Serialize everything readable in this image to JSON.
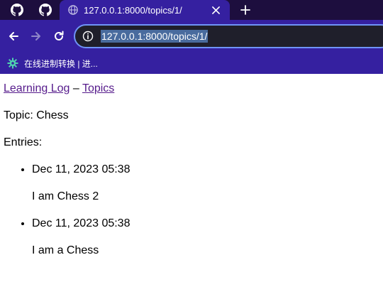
{
  "browser": {
    "pinned_tabs": [
      {
        "icon": "github-icon"
      },
      {
        "icon": "github-icon"
      }
    ],
    "active_tab": {
      "icon": "globe-icon",
      "title": "127.0.0.1:8000/topics/1/",
      "close_icon": "close-icon"
    },
    "new_tab_icon": "plus-icon",
    "toolbar": {
      "back_icon": "back-arrow-icon",
      "forward_icon": "forward-arrow-icon",
      "reload_icon": "reload-icon",
      "url": "127.0.0.1:8000/topics/1/",
      "site_info_icon": "info-icon"
    },
    "bookmarks": [
      {
        "icon": "gear-icon",
        "label": "在线进制转换 | 进..."
      }
    ],
    "colors": {
      "tabstrip": "#1d0e3e",
      "toolbar": "#3520a0",
      "omnibox_bg": "#1f1f2b",
      "omnibox_border": "#6f93f7",
      "url_highlight": "#496b9e"
    }
  },
  "page": {
    "nav": {
      "home_link": "Learning Log",
      "separator": "–",
      "topics_link": "Topics"
    },
    "topic_line": "Topic: Chess",
    "entries_label": "Entries:",
    "entries": [
      {
        "date": "Dec 11, 2023 05:38",
        "text": "I am Chess 2"
      },
      {
        "date": "Dec 11, 2023 05:38",
        "text": "I am a Chess"
      }
    ],
    "colors": {
      "link": "#551a8b",
      "text": "#000000"
    }
  }
}
